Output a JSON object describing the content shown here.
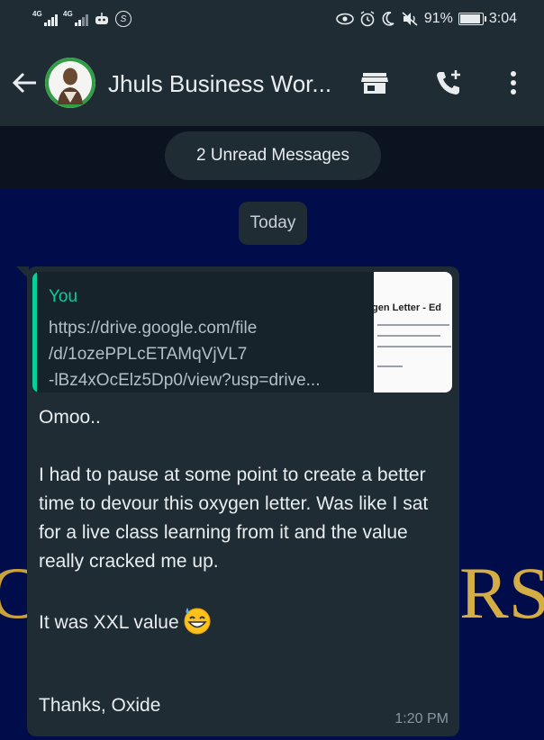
{
  "status_bar": {
    "net1_label": "4G",
    "net2_label": "4G",
    "battery_level": "91%",
    "time": "3:04",
    "icons": [
      "signal-icon",
      "signal-icon",
      "robot-icon",
      "s-circle-icon",
      "eye-icon",
      "alarm-icon",
      "moon-icon",
      "mute-icon",
      "battery-icon"
    ]
  },
  "header": {
    "title": "Jhuls Business Wor...",
    "icons": [
      "back-arrow-icon",
      "store-icon",
      "add-call-icon",
      "more-vert-icon"
    ]
  },
  "unread_label": "2 Unread Messages",
  "date_separator": "Today",
  "message": {
    "quote_sender": "You",
    "quote_text": "https://drive.google.com/file\n/d/1ozePPLcETAMqVjVL7\n-lBz4xOcElz5Dp0/view?usp=drive...",
    "thumbnail_title": "gen Letter - Ed",
    "body_text": "Omoo..\n\nI had to pause at some point to create a better time to devour this oxygen letter. Was like I sat for a live class learning from it and the value really cracked me up.\n\nIt was XXL value",
    "closing": "Thanks, Oxide",
    "time": "1:20 PM",
    "emoji": "grinning-sweat-emoji"
  },
  "background_text": {
    "left": "C",
    "right": "RS"
  },
  "colors": {
    "chat_background": "#000d4a",
    "bar_background": "#1f2c34",
    "accent": "#06cf9c",
    "text": "#e9edef"
  }
}
